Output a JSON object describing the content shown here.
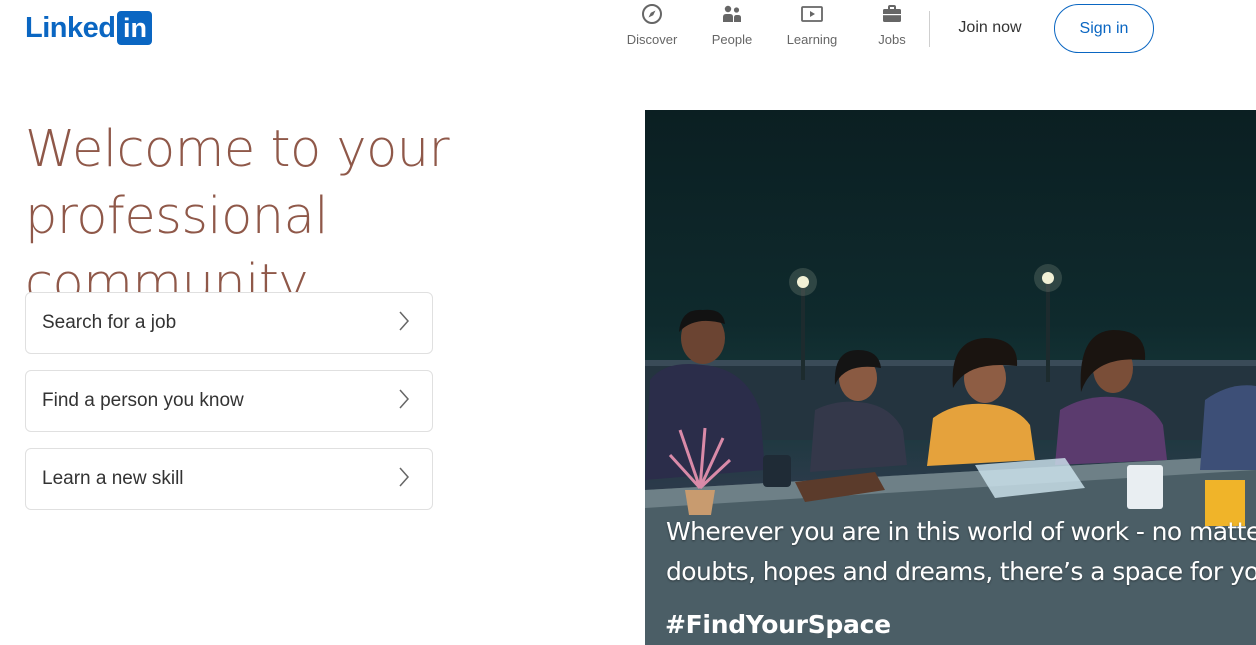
{
  "header": {
    "logo_text": "Linked",
    "logo_box_text": "in",
    "nav": [
      {
        "label": "Discover",
        "icon": "compass-icon"
      },
      {
        "label": "People",
        "icon": "people-icon"
      },
      {
        "label": "Learning",
        "icon": "learning-icon"
      },
      {
        "label": "Jobs",
        "icon": "briefcase-icon"
      }
    ],
    "join_label": "Join now",
    "signin_label": "Sign in"
  },
  "hero": {
    "title_line1": "Welcome to your",
    "title_line2": "professional community",
    "cards": [
      {
        "label": "Search for a job"
      },
      {
        "label": "Find a person you know"
      },
      {
        "label": "Learn a new skill"
      }
    ]
  },
  "photo": {
    "caption_line1": "Wherever you are in this world of work - no matter your",
    "caption_line2": "doubts, hopes and dreams, there’s a space for you here",
    "hashtag": "#FindYourSpace"
  },
  "colors": {
    "brand": "#0a66c2",
    "title": "#8f5849",
    "nav_text": "#666666"
  }
}
